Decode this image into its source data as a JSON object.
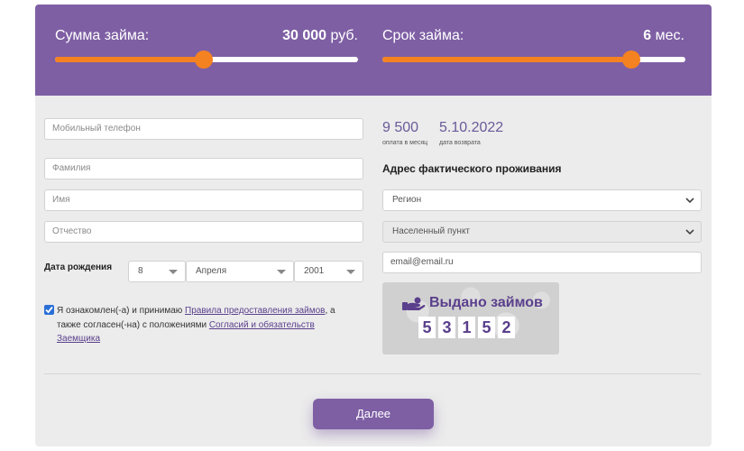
{
  "colors": {
    "header": "#7e5fa4",
    "accent_orange": "#f58220",
    "link": "#5a3f8c"
  },
  "sliders": [
    {
      "label": "Сумма займа:",
      "value": "30 000",
      "unit": "руб.",
      "fill_percent": 49
    },
    {
      "label": "Срок займа:",
      "value": "6",
      "unit": "мес.",
      "fill_percent": 82
    }
  ],
  "form": {
    "phone_placeholder": "Мобильный телефон",
    "lastname_placeholder": "Фамилия",
    "firstname_placeholder": "Имя",
    "patronymic_placeholder": "Отчество",
    "dob_label": "Дата рождения",
    "dob_day": "8",
    "dob_month": "Апреля",
    "dob_year": "2001",
    "agree_text_1": "Я ознакомлен(-а) и принимаю ",
    "agree_link_1": "Правила предоставления займов",
    "agree_text_2": ", а также согласен(-на) с положениями ",
    "agree_link_2": "Согласий и обязательств Заемщика",
    "agree_checked": true
  },
  "summary": {
    "monthly_payment": "9 500",
    "monthly_caption": "оплата в месяц",
    "return_date": "5.10.2022",
    "return_caption": "дата возврата"
  },
  "address": {
    "title": "Адрес фактического проживания",
    "region_placeholder": "Регион",
    "city_placeholder": "Населенный пункт",
    "email_placeholder": "email@email.ru"
  },
  "counter": {
    "title": "Выдано займов",
    "digits": [
      "5",
      "3",
      "1",
      "5",
      "2"
    ],
    "icon": "hand-money-icon"
  },
  "submit_label": "Далее"
}
